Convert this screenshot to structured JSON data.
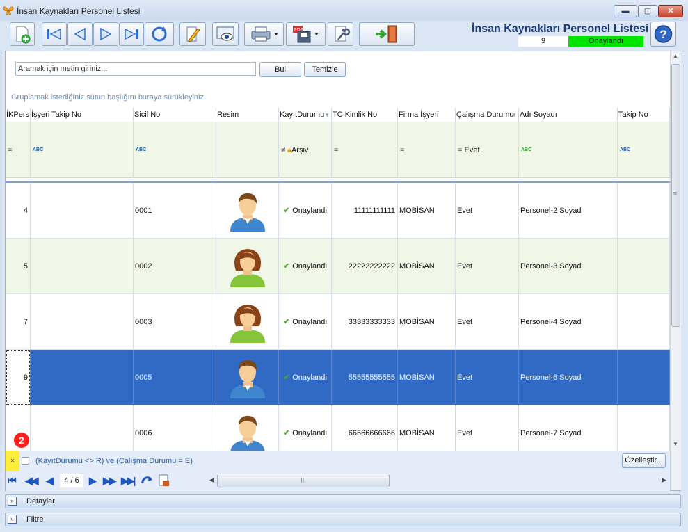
{
  "window": {
    "title": "İnsan Kaynakları Personel Listesi",
    "minimize": "▬",
    "maximize": "▢",
    "close": "✕"
  },
  "header": {
    "title": "İnsan Kaynakları Personel Listesi",
    "count": "9",
    "status": "Onaylandı",
    "help": "?"
  },
  "search": {
    "placeholder": "Aramak için metin giriniz...",
    "find_label": "Bul",
    "clear_label": "Temizle"
  },
  "group_hint": "Gruplamak istediğiniz sütun başlığını buraya sürükleyiniz",
  "columns": [
    "İKPers",
    "İşyeri Takip No",
    "Sicil No",
    "Resim",
    "KayıtDurumu",
    "TC Kimlik No",
    "Firma İşyeri",
    "Çalışma Durumu",
    "Adı Soyadı",
    "Takip No"
  ],
  "filter_row": {
    "eq": "=",
    "neq": "≠",
    "abc": "ABC",
    "kayit_value": "Arşiv",
    "calisma_value": "Evet"
  },
  "rows": [
    {
      "id": "4",
      "sicil": "0001",
      "gender": "male",
      "status": "Onaylandı",
      "tc": "11111111111",
      "firma": "MOBİSAN",
      "calisma": "Evet",
      "name": "Personel-2 Soyad"
    },
    {
      "id": "5",
      "sicil": "0002",
      "gender": "female",
      "status": "Onaylandı",
      "tc": "22222222222",
      "firma": "MOBİSAN",
      "calisma": "Evet",
      "name": "Personel-3 Soyad"
    },
    {
      "id": "7",
      "sicil": "0003",
      "gender": "female",
      "status": "Onaylandı",
      "tc": "33333333333",
      "firma": "MOBİSAN",
      "calisma": "Evet",
      "name": "Personel-4 Soyad"
    },
    {
      "id": "9",
      "sicil": "0005",
      "gender": "male",
      "status": "Onaylandı",
      "tc": "55555555555",
      "firma": "MOBİSAN",
      "calisma": "Evet",
      "name": "Personel-6 Soyad"
    },
    {
      "id": "",
      "sicil": "0006",
      "gender": "male",
      "status": "Onaylandı",
      "tc": "66666666666",
      "firma": "MOBİSAN",
      "calisma": "Evet",
      "name": "Personel-7 Soyad"
    }
  ],
  "selected_row_index": 3,
  "filter_bar": {
    "close": "×",
    "expression": "(KayıtDurumu <> R) ve (Çalışma Durumu = E)",
    "customize": "Özelleştir...",
    "badge": "2"
  },
  "navigator": {
    "page": "4 / 6",
    "first": "⏮",
    "prev_page": "◀◀",
    "prev": "◀",
    "next": "▶",
    "next_page": "▶▶",
    "last": "▶▶|"
  },
  "scroll": {
    "grip": "III",
    "left": "◀",
    "right": "▶",
    "up": "▲",
    "down": "▼",
    "grip_v": "≡"
  },
  "panels": {
    "details": "Detaylar",
    "filter": "Filtre"
  },
  "colors": {
    "selected": "#316ac5",
    "approved": "#00e400",
    "filter_row": "#f0f7e6",
    "alt_row": "#f0f7e6"
  }
}
